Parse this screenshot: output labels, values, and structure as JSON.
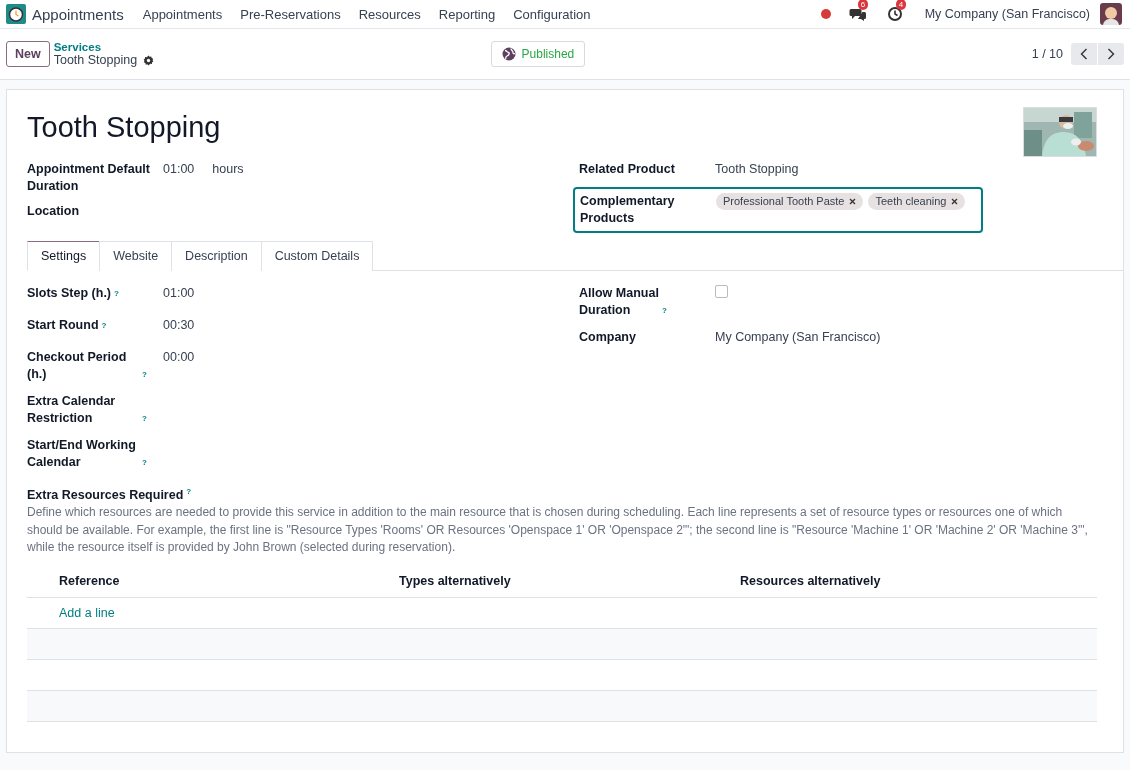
{
  "navbar": {
    "app_name": "Appointments",
    "menu": [
      "Appointments",
      "Pre-Reservations",
      "Resources",
      "Reporting",
      "Configuration"
    ],
    "messages_count": "6",
    "activities_count": "4",
    "company": "My Company (San Francisco)"
  },
  "control_panel": {
    "new_button": "New",
    "breadcrumb_parent": "Services",
    "breadcrumb_current": "Tooth Stopping",
    "published": "Published",
    "pager": "1 / 10"
  },
  "form": {
    "title": "Tooth Stopping",
    "left_fields": [
      {
        "label": "Appointment Default Duration",
        "value": "01:00",
        "unit": "hours"
      },
      {
        "label": "Location"
      }
    ],
    "related_product": {
      "label": "Related Product",
      "value": "Tooth Stopping"
    },
    "complementary_products": {
      "label": "Complementary Products",
      "tags": [
        "Professional Tooth Paste",
        "Teeth cleaning"
      ],
      "focused": true
    },
    "tabs": [
      {
        "label": "Settings",
        "selected": true
      },
      {
        "label": "Website",
        "selected": false
      },
      {
        "label": "Description",
        "selected": false
      },
      {
        "label": "Custom Details",
        "selected": false
      }
    ],
    "settings_left": [
      {
        "label": "Slots Step (h.)",
        "help": "?",
        "value": "01:00"
      },
      {
        "label": "Start Round",
        "help": "?",
        "value": "00:30"
      },
      {
        "label": "Checkout Period (h.)",
        "help": "?",
        "value": "00:00"
      },
      {
        "label": "Extra Calendar Restriction",
        "help": "?"
      },
      {
        "label": "Start/End Working Calendar",
        "help": "?"
      }
    ],
    "allow_manual_duration": {
      "label": "Allow Manual Duration",
      "help": "?",
      "checked": false
    },
    "company": {
      "label": "Company",
      "value": "My Company (San Francisco)"
    },
    "extra_resources": {
      "label": "Extra Resources Required",
      "help": "?",
      "description": "Define which resources are needed to provide this service in addition to the main resource that is chosen during scheduling. Each line represents a set of resource types or resources one of which should be available. For example, the first line is \"Resource Types 'Rooms' OR Resources 'Openspace 1' OR 'Openspace 2'\"; the second line is \"Resource 'Machine 1' OR 'Machine 2' OR 'Machine 3'\", while the resource itself is provided by John Brown (selected during reservation).",
      "columns": [
        "Reference",
        "Types alternatively",
        "Resources alternatively"
      ],
      "add_line": "Add a line"
    }
  }
}
